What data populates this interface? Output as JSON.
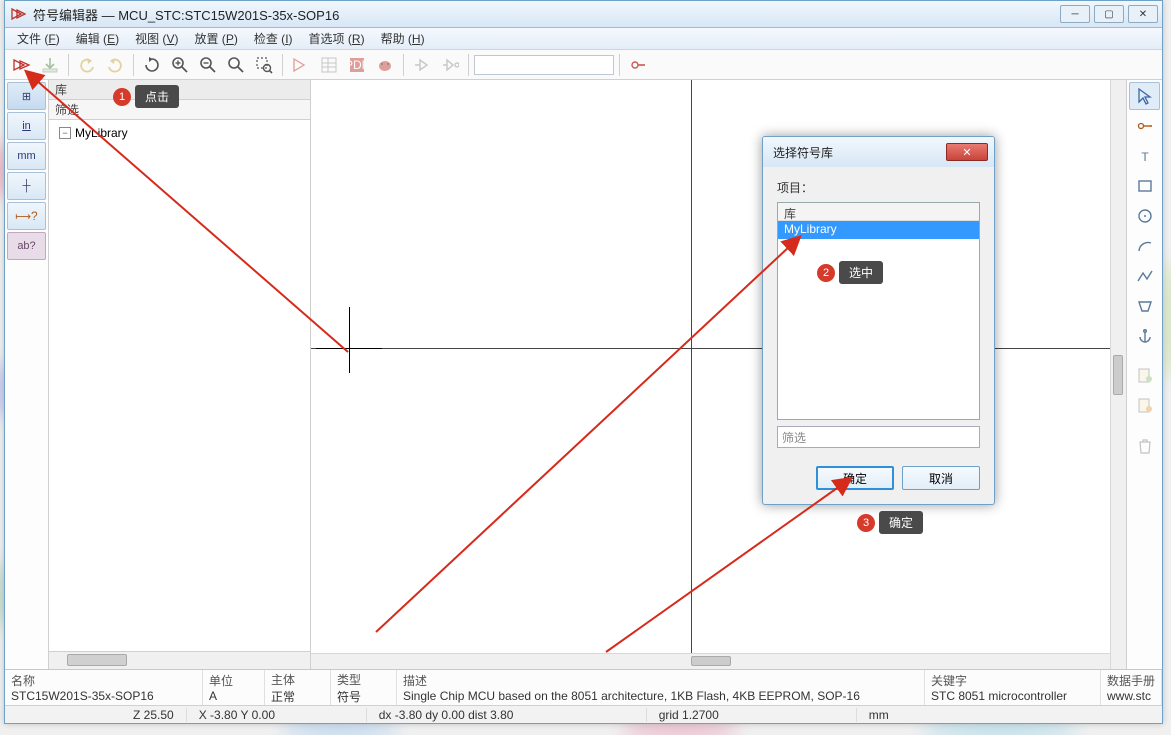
{
  "window": {
    "title": "符号编辑器 — MCU_STC:STC15W201S-35x-SOP16"
  },
  "menu": [
    {
      "label": "文件",
      "key": "F"
    },
    {
      "label": "编辑",
      "key": "E"
    },
    {
      "label": "视图",
      "key": "V"
    },
    {
      "label": "放置",
      "key": "P"
    },
    {
      "label": "检查",
      "key": "I"
    },
    {
      "label": "首选项",
      "key": "R"
    },
    {
      "label": "帮助",
      "key": "H"
    }
  ],
  "left_strip": [
    {
      "name": "grid-icon",
      "txt": "⊞"
    },
    {
      "name": "inch-unit",
      "txt": "in"
    },
    {
      "name": "mm-unit",
      "txt": "mm"
    },
    {
      "name": "cursor-full",
      "txt": "┼"
    },
    {
      "name": "pin-help",
      "txt": "⟼?"
    },
    {
      "name": "label-help",
      "txt": "ab?"
    }
  ],
  "lib_panel": {
    "head": "库",
    "filter_label": "筛选",
    "tree_item": "MyLibrary"
  },
  "dialog": {
    "title": "选择符号库",
    "label": "项目：",
    "header": "库",
    "item": "MyLibrary",
    "filter": "筛选",
    "ok": "确定",
    "cancel": "取消"
  },
  "callouts": {
    "c1": "点击",
    "c2": "选中",
    "c3": "确定"
  },
  "right_strip_icons": [
    "arrow",
    "pin",
    "text",
    "rect",
    "circle",
    "arc",
    "curve",
    "poly",
    "anchor",
    "sheet1",
    "sheet2",
    "trash"
  ],
  "info": {
    "name_lbl": "名称",
    "name_val": "STC15W201S-35x-SOP16",
    "unit_lbl": "单位",
    "unit_val": "A",
    "body_lbl": "主体",
    "body_val": "正常",
    "type_lbl": "类型",
    "type_val": "符号",
    "desc_lbl": "描述",
    "desc_val": "Single Chip MCU based on the 8051 architecture, 1KB Flash, 4KB EEPROM, SOP-16",
    "key_lbl": "关键字",
    "key_val": "STC 8051 microcontroller",
    "ds_lbl": "数据手册",
    "ds_val": "www.stc"
  },
  "status": {
    "z": "Z 25.50",
    "xy": "X -3.80  Y 0.00",
    "d": "dx -3.80  dy 0.00  dist 3.80",
    "grid": "grid 1.2700",
    "unit": "mm"
  }
}
